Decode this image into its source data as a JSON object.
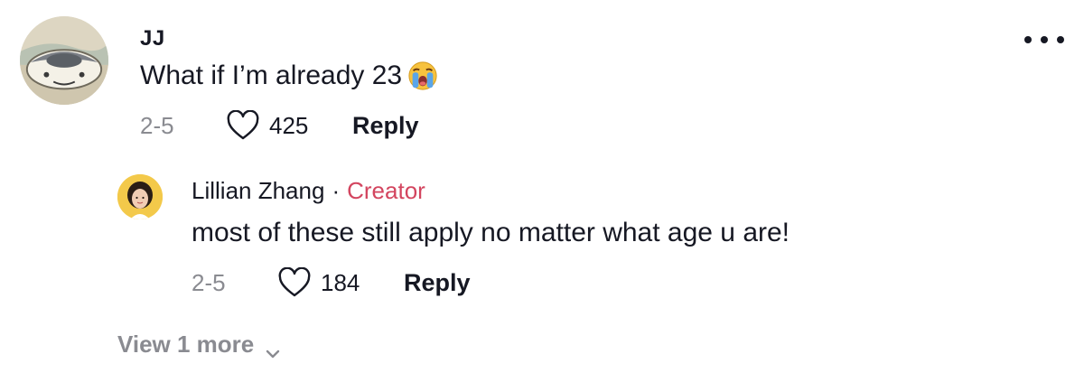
{
  "comment": {
    "username": "JJ",
    "text": "What if I’m already 23",
    "emoji": "loudly-crying-face-icon",
    "date": "2-5",
    "likes": "425",
    "reply_label": "Reply"
  },
  "reply": {
    "username": "Lillian Zhang",
    "separator": "·",
    "badge": "Creator",
    "text": "most of these still apply no matter what age u are!",
    "date": "2-5",
    "likes": "184",
    "reply_label": "Reply"
  },
  "view_more": {
    "label": "View 1 more"
  },
  "colors": {
    "text": "#161823",
    "muted": "#8a8b91",
    "creator": "#d3455f"
  }
}
